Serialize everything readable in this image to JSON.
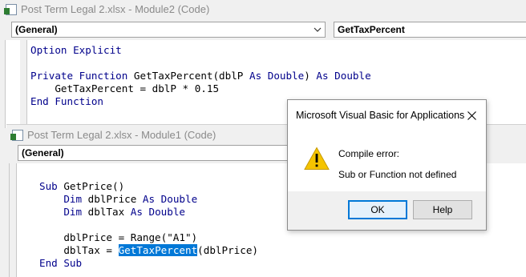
{
  "module2": {
    "title": "Post Term Legal 2.xlsx - Module2 (Code)",
    "object_combo": "(General)",
    "procedure_combo": "GetTaxPercent",
    "code": [
      [
        {
          "t": "Option Explicit",
          "k": true
        }
      ],
      [],
      [
        {
          "t": "Private Function",
          "k": true
        },
        {
          "t": " GetTaxPercent(dblP "
        },
        {
          "t": "As Double",
          "k": true
        },
        {
          "t": ") "
        },
        {
          "t": "As Double",
          "k": true
        }
      ],
      [
        {
          "t": "    GetTaxPercent = dblP * 0.15"
        }
      ],
      [
        {
          "t": "End Function",
          "k": true
        }
      ]
    ]
  },
  "module1": {
    "title": "Post Term Legal 2.xlsx - Module1 (Code)",
    "object_combo": "(General)",
    "code": [
      [],
      [
        {
          "t": "Sub",
          "k": true
        },
        {
          "t": " GetPrice()"
        }
      ],
      [
        {
          "t": "    "
        },
        {
          "t": "Dim",
          "k": true
        },
        {
          "t": " dblPrice "
        },
        {
          "t": "As Double",
          "k": true
        }
      ],
      [
        {
          "t": "    "
        },
        {
          "t": "Dim",
          "k": true
        },
        {
          "t": " dblTax "
        },
        {
          "t": "As Double",
          "k": true
        }
      ],
      [],
      [
        {
          "t": "    dblPrice = Range(\"A1\")"
        }
      ],
      [
        {
          "t": "    dblTax = "
        },
        {
          "t": "GetTaxPercent",
          "sel": true
        },
        {
          "t": "(dblPrice)"
        }
      ],
      [
        {
          "t": "End Sub",
          "k": true
        }
      ]
    ]
  },
  "dialog": {
    "title": "Microsoft Visual Basic for Applications",
    "heading": "Compile error:",
    "message": "Sub or Function not defined",
    "ok_label": "OK",
    "help_label": "Help",
    "icon": "warning-icon"
  },
  "colors": {
    "keyword": "#00008b",
    "selection": "#0078d7",
    "warning": "#f5c400"
  }
}
